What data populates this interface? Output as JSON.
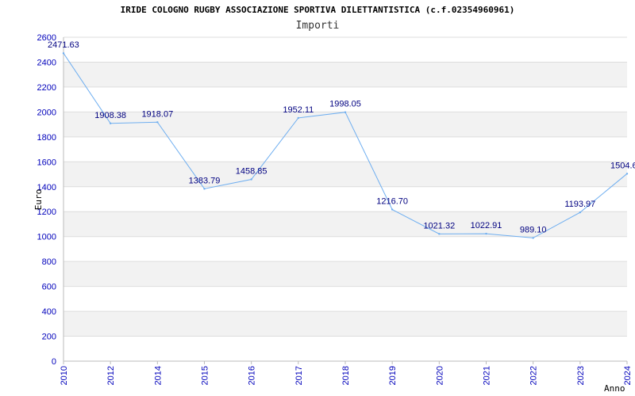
{
  "chart_data": {
    "type": "line",
    "title": "IRIDE COLOGNO RUGBY ASSOCIAZIONE SPORTIVA DILETTANTISTICA (c.f.02354960961)",
    "subtitle": "Importi",
    "xlabel": "Anno",
    "ylabel": "Euro",
    "categories": [
      "2010",
      "2012",
      "2014",
      "2015",
      "2016",
      "2017",
      "2018",
      "2019",
      "2020",
      "2021",
      "2022",
      "2023",
      "2024"
    ],
    "values": [
      2471.63,
      1908.38,
      1918.07,
      1383.79,
      1458.85,
      1952.11,
      1998.05,
      1216.7,
      1021.32,
      1022.91,
      989.1,
      1193.97,
      1504.6
    ],
    "data_labels": [
      "2471.63",
      "1908.38",
      "1918.07",
      "1383.79",
      "1458.85",
      "1952.11",
      "1998.05",
      "1216.70",
      "1021.32",
      "1022.91",
      "989.10",
      "1193.97",
      "1504.6"
    ],
    "ylim": [
      0,
      2600
    ],
    "yticks": [
      0,
      200,
      400,
      600,
      800,
      1000,
      1200,
      1400,
      1600,
      1800,
      2000,
      2200,
      2400,
      2600
    ],
    "grid": true,
    "colors": {
      "line": "#6eaef0",
      "label": "#000080",
      "axis_text": "#0000bb",
      "band": "#f2f2f2",
      "grid": "#dddddd"
    }
  }
}
